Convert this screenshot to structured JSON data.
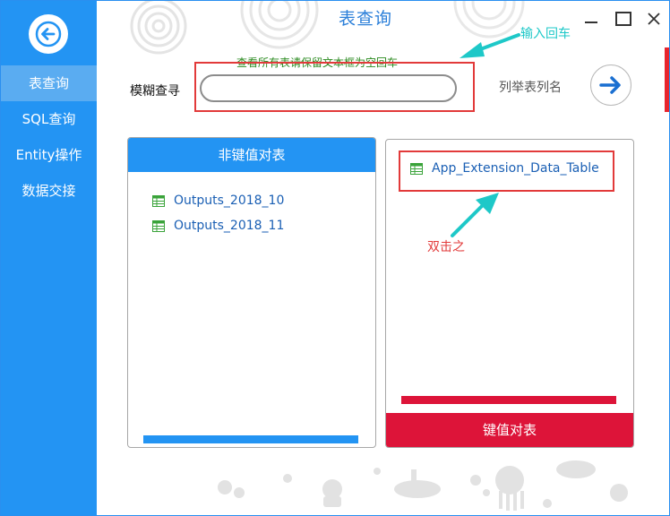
{
  "window": {
    "title": "表查询",
    "controls": {
      "minimize": "—",
      "maximize": "☐",
      "close": "✕"
    }
  },
  "sidebar": {
    "back_icon": "arrow-left-icon",
    "items": [
      {
        "label": "表查询",
        "active": true
      },
      {
        "label": "SQL查询",
        "active": false
      },
      {
        "label": "Entity操作",
        "active": false
      },
      {
        "label": "数据交接",
        "active": false
      }
    ]
  },
  "search": {
    "hint": "查看所有表请保留文本框为空回车",
    "label": "模糊查寻",
    "value": "",
    "placeholder": ""
  },
  "list_columns": {
    "label": "列举表列名",
    "go_icon": "arrow-right-icon"
  },
  "annotations": {
    "enter": "输入回车",
    "double_click": "双击之"
  },
  "panels": {
    "non_keyed": {
      "header": "非键值对表",
      "items": [
        "Outputs_2018_10",
        "Outputs_2018_11"
      ]
    },
    "keyed": {
      "footer": "键值对表",
      "items": [
        "App_Extension_Data_Table"
      ]
    }
  },
  "colors": {
    "sidebar": "#2394f3",
    "accent_blue": "#2394f3",
    "accent_red": "#dd1439",
    "annotation_cyan": "#1ec8c8",
    "annotation_red": "#e23a3a",
    "hint_green": "#2a8a1f"
  }
}
